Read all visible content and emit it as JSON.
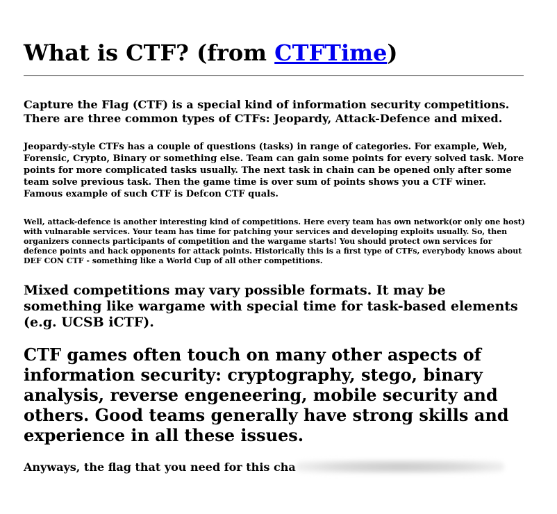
{
  "heading": {
    "prefix": "What is CTF? (from ",
    "link_text": "CTFTime",
    "suffix": ")"
  },
  "paragraphs": {
    "intro": "Capture the Flag (CTF) is a special kind of information security competitions. There are three common types of CTFs: Jeopardy, Attack-Defence and mixed.",
    "jeopardy": "Jeopardy-style CTFs has a couple of questions (tasks) in range of categories. For example, Web, Forensic, Crypto, Binary or something else. Team can gain some points for every solved task. More points for more complicated tasks usually. The next task in chain can be opened only after some team solve previous task. Then the game time is over sum of points shows you a CTF winer. Famous example of such CTF is Defcon CTF quals.",
    "attack_defence": "Well, attack-defence is another interesting kind of competitions. Here every team has own network(or only one host) with vulnarable services. Your team has time for patching your services and developing exploits usually. So, then organizers connects participants of competition and the wargame starts! You should protect own services for defence points and hack opponents for attack points. Historically this is a first type of CTFs, everybody knows about DEF CON CTF - something like a World Cup of all other competitions.",
    "mixed": "Mixed competitions may vary possible formats. It may be something like wargame with special time for task-based elements (e.g. UCSB iCTF).",
    "aspects": "CTF games often touch on many other aspects of information security: cryptography, stego, binary analysis, reverse engeneering, mobile security and others. Good teams generally have strong skills and experience in all these issues.",
    "flag": "Anyways, the flag that you need for this cha"
  }
}
